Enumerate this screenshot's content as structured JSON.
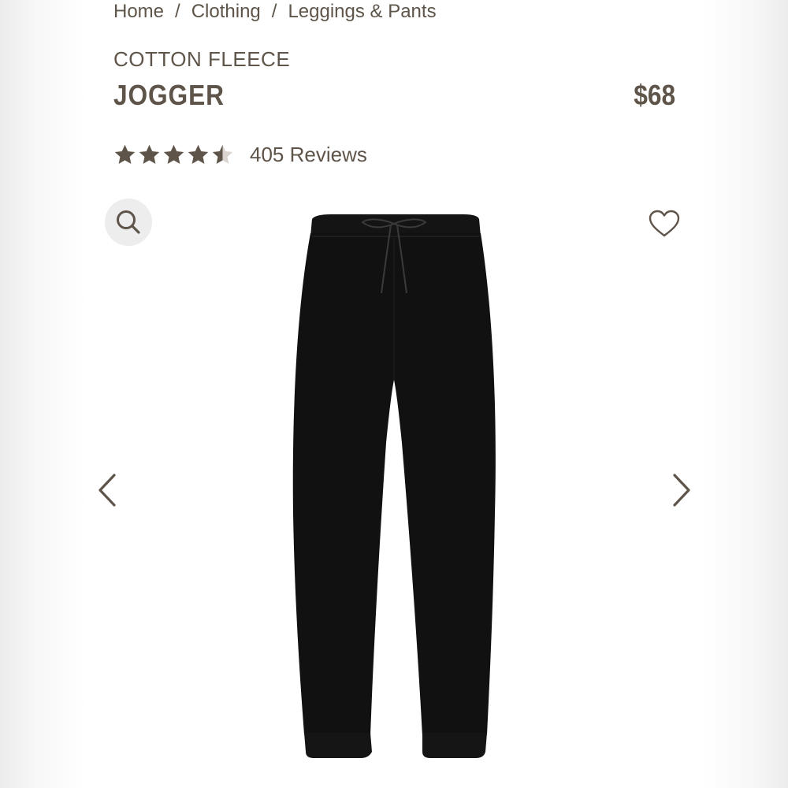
{
  "breadcrumb": {
    "items": [
      "Home",
      "Clothing",
      "Leggings & Pants"
    ],
    "separator": "/"
  },
  "product": {
    "collection": "COTTON FLEECE",
    "name": "JOGGER",
    "price": "$68",
    "rating": 4.5,
    "rating_max": 5,
    "review_count_label": "405 Reviews",
    "image_color": "#111111"
  },
  "icons": {
    "search": "search-icon",
    "wishlist": "heart-icon",
    "prev": "chevron-left-icon",
    "next": "chevron-right-icon"
  },
  "colors": {
    "text": "#5e5449",
    "search_bg": "#ededed"
  }
}
